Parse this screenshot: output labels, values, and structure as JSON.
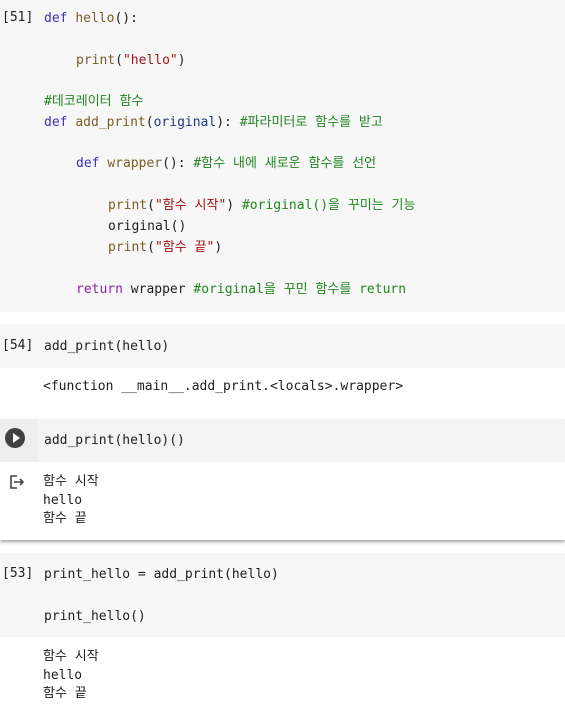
{
  "cell51": {
    "exec": "[51]",
    "lines": [
      {
        "kw": "def",
        "fn": "hello",
        "rest": "():"
      },
      {
        "fn": "print",
        "str": "\"hello\"",
        "rest": ")"
      },
      {
        "cmt": "#데코레이터 함수"
      },
      {
        "kw": "def",
        "fn": "add_print",
        "arg": "original",
        "cmt": "#파라미터로 함수를 받고"
      },
      {
        "kw": "def",
        "fn": "wrapper",
        "cmt": "#함수 내에 새로운 함수를 선언"
      },
      {
        "fn": "print",
        "str": "\"함수 시작\"",
        "cmt": "#original()을 꾸미는 기능"
      },
      {
        "text": "original()"
      },
      {
        "fn": "print",
        "str": "\"함수 끝\""
      },
      {
        "ret": "return",
        "text": "wrapper",
        "cmt": "#original을 꾸민 함수를 return"
      }
    ]
  },
  "cell54": {
    "exec": "[54]",
    "code": "add_print(hello)",
    "output": "<function __main__.add_print.<locals>.wrapper>"
  },
  "cell_active": {
    "code": "add_print(hello)()",
    "output": [
      "함수 시작",
      "hello",
      "함수 끝"
    ]
  },
  "cell53": {
    "exec": "[53]",
    "code1": "print_hello = add_print(hello)",
    "code2": "print_hello()",
    "output": [
      "함수 시작",
      "hello",
      "함수 끝"
    ]
  },
  "icons": {
    "run": "play-circle-icon",
    "output": "output-redirect-icon"
  }
}
